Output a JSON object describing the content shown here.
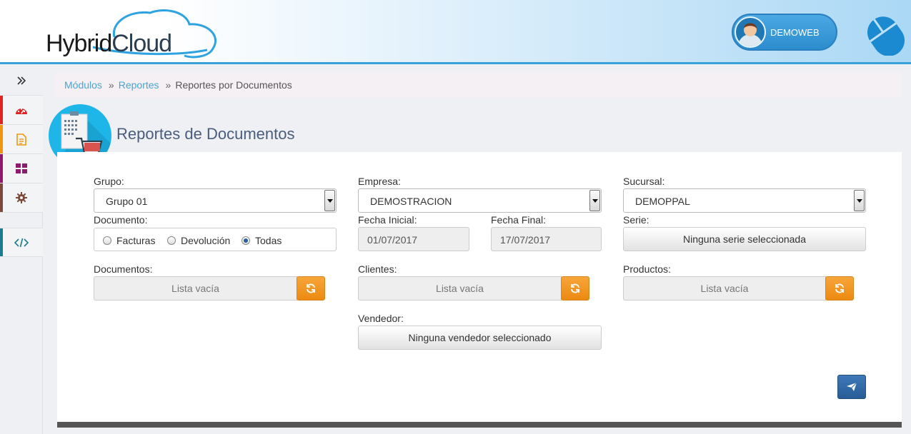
{
  "header": {
    "logo_part1": "Hybrid",
    "logo_part2": "Cloud",
    "user_name": "DEMOWEB"
  },
  "sidebar": {
    "items": [
      {
        "icon": "double-chevron-right-icon",
        "color": "#333333"
      },
      {
        "icon": "dashboard-gauge-icon",
        "color": "#e02424",
        "bar": "#e02424"
      },
      {
        "icon": "document-icon",
        "color": "#f0960e",
        "bar": "#f0960e"
      },
      {
        "icon": "grid-icon",
        "color": "#8e1a6e",
        "bar": "#8e1a6e"
      },
      {
        "icon": "gear-icon",
        "color": "#7b4a3a",
        "bar": "#7b4a3a"
      },
      {
        "icon": "code-icon",
        "color": "#1a7c8c",
        "bar": "#1a7c8c"
      }
    ]
  },
  "breadcrumb": {
    "item1": "Módulos",
    "item2": "Reportes",
    "current": "Reportes por Documentos"
  },
  "page": {
    "title": "Reportes de Documentos"
  },
  "form": {
    "grupo_label": "Grupo:",
    "grupo_value": "Grupo 01",
    "empresa_label": "Empresa:",
    "empresa_value": "DEMOSTRACION",
    "sucursal_label": "Sucursal:",
    "sucursal_value": "DEMOPPAL",
    "documento_label": "Documento:",
    "radio_facturas": "Facturas",
    "radio_devolucion": "Devolución",
    "radio_todas": "Todas",
    "radio_selected": "Todas",
    "fecha_inicial_label": "Fecha Inicial:",
    "fecha_inicial_value": "01/07/2017",
    "fecha_final_label": "Fecha Final:",
    "fecha_final_value": "17/07/2017",
    "serie_label": "Serie:",
    "serie_button": "Ninguna serie seleccionada",
    "documentos_label": "Documentos:",
    "documentos_list": "Lista vacía",
    "clientes_label": "Clientes:",
    "clientes_list": "Lista vacía",
    "productos_label": "Productos:",
    "productos_list": "Lista vacía",
    "vendedor_label": "Vendedor:",
    "vendedor_button": "Ninguna vendedor seleccionado"
  },
  "colors": {
    "accent": "#4ba3d4",
    "orange": "#f0960e",
    "send": "#2d679f"
  }
}
